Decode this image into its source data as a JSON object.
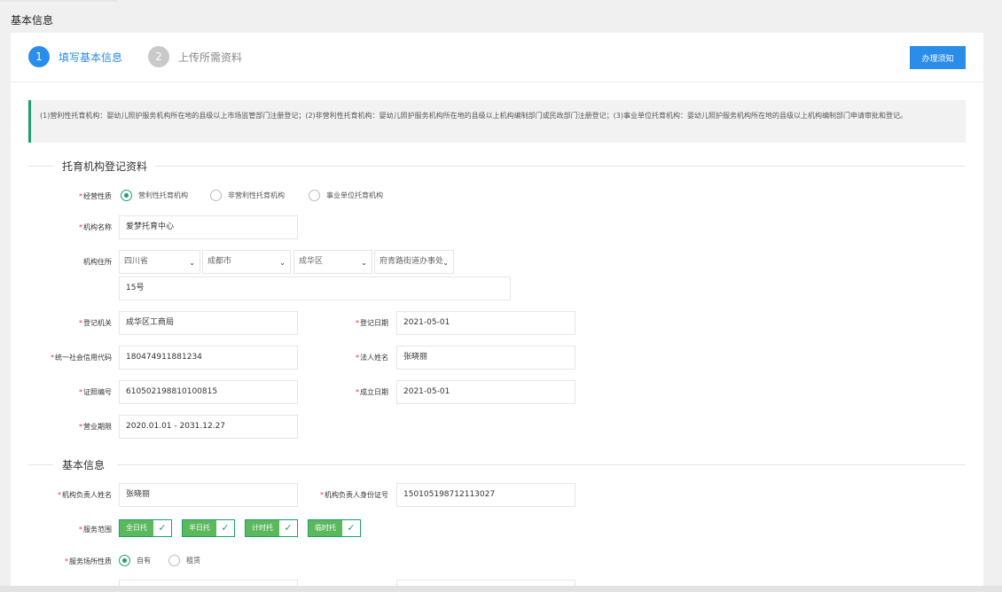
{
  "page_title": "基本信息",
  "steps": [
    {
      "number": "1",
      "label": "填写基本信息"
    },
    {
      "number": "2",
      "label": "上传所需资料"
    }
  ],
  "notice_button": "办理须知",
  "notice_text": "(1)营利性托育机构：婴幼儿照护服务机构所在地的县级以上市场监管部门注册登记；(2)非营利性托育机构：婴幼儿照护服务机构所在地的县级以上机构编制部门或民政部门注册登记；(3)事业单位托育机构：婴幼儿照护服务机构所在地的县级以上机构编制部门申请审批和登记。",
  "section1_title": "托育机构登记资料",
  "section2_title": "基本信息",
  "required_mark": "*",
  "business_nature": {
    "label": "经营性质",
    "options": [
      "营利性托育机构",
      "非营利性托育机构",
      "事业单位托育机构"
    ],
    "selected": "营利性托育机构"
  },
  "org_name": {
    "label": "机构名称",
    "value": "爱梦托育中心"
  },
  "address": {
    "label": "机构住所",
    "province": "四川省",
    "city": "成都市",
    "district": "成华区",
    "street": "府青路街道办事处",
    "detail": "15号"
  },
  "reg_authority": {
    "label": "登记机关",
    "value": "成华区工商局"
  },
  "reg_date": {
    "label": "登记日期",
    "value": "2021-05-01"
  },
  "credit_code": {
    "label": "统一社会信用代码",
    "value": "180474911881234"
  },
  "legal_person": {
    "label": "法人姓名",
    "value": "张晓丽"
  },
  "license_no": {
    "label": "证照编号",
    "value": "610502198810100815"
  },
  "established_date": {
    "label": "成立日期",
    "value": "2021-05-01"
  },
  "business_term": {
    "label": "营业期限",
    "value": "2020.01.01 - 2031.12.27"
  },
  "manager_name": {
    "label": "机构负责人姓名",
    "value": "张晓丽"
  },
  "manager_id": {
    "label": "机构负责人身份证号",
    "value": "150105198712113027"
  },
  "service_scope": {
    "label": "服务范围",
    "options": [
      "全日托",
      "半日托",
      "计时托",
      "临时托"
    ]
  },
  "venue_nature": {
    "label": "服务场所性质",
    "options": [
      "自有",
      "租赁"
    ],
    "selected": "自有"
  },
  "colors": {
    "accent": "#2a8de9",
    "green": "#1aa26c",
    "chip": "#5cb85c",
    "required": "#e33333"
  }
}
